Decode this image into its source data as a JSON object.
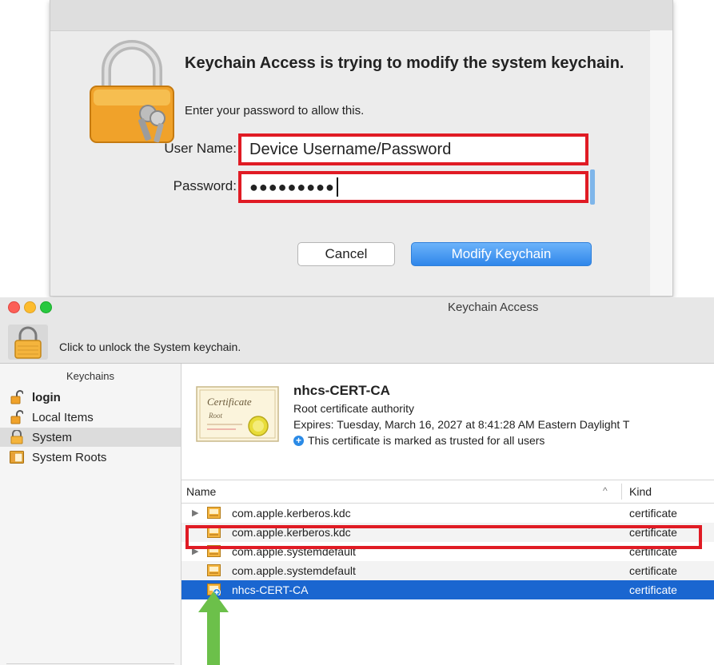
{
  "dialog": {
    "title": "Keychain Access is trying to modify the system keychain.",
    "subtitle": "Enter your password to allow this.",
    "username_label": "User Name:",
    "username_value": "Device Username/Password",
    "password_label": "Password:",
    "password_value": "●●●●●●●●●",
    "cancel_label": "Cancel",
    "modify_label": "Modify Keychain"
  },
  "window": {
    "title": "Keychain Access",
    "unlock_text": "Click to unlock the System keychain."
  },
  "sidebar": {
    "heading": "Keychains",
    "items": [
      {
        "label": "login",
        "icon": "unlocked-lock-icon"
      },
      {
        "label": "Local Items",
        "icon": "unlocked-lock-icon"
      },
      {
        "label": "System",
        "icon": "lock-icon",
        "selected": true
      },
      {
        "label": "System Roots",
        "icon": "cabinet-icon"
      }
    ]
  },
  "detail": {
    "thumb_text_1": "Certificate",
    "thumb_text_2": "Root",
    "name": "nhcs-CERT-CA",
    "type": "Root certificate authority",
    "expires": "Expires: Tuesday, March 16, 2027 at 8:41:28 AM Eastern Daylight T",
    "trust": "This certificate is marked as trusted for all users"
  },
  "table": {
    "headers": {
      "name": "Name",
      "sort": "^",
      "kind": "Kind"
    },
    "rows": [
      {
        "name": "com.apple.kerberos.kdc",
        "kind": "certificate",
        "disclosure": "▶"
      },
      {
        "name": "com.apple.kerberos.kdc",
        "kind": "certificate",
        "disclosure": ""
      },
      {
        "name": "com.apple.systemdefault",
        "kind": "certificate",
        "disclosure": "▶"
      },
      {
        "name": "com.apple.systemdefault",
        "kind": "certificate",
        "disclosure": ""
      },
      {
        "name": "nhcs-CERT-CA",
        "kind": "certificate",
        "disclosure": "",
        "selected": true
      }
    ]
  },
  "colors": {
    "highlight": "#e01b24",
    "accent": "#2f86ea",
    "selection": "#1a66d0",
    "arrow": "#6cc04a"
  }
}
